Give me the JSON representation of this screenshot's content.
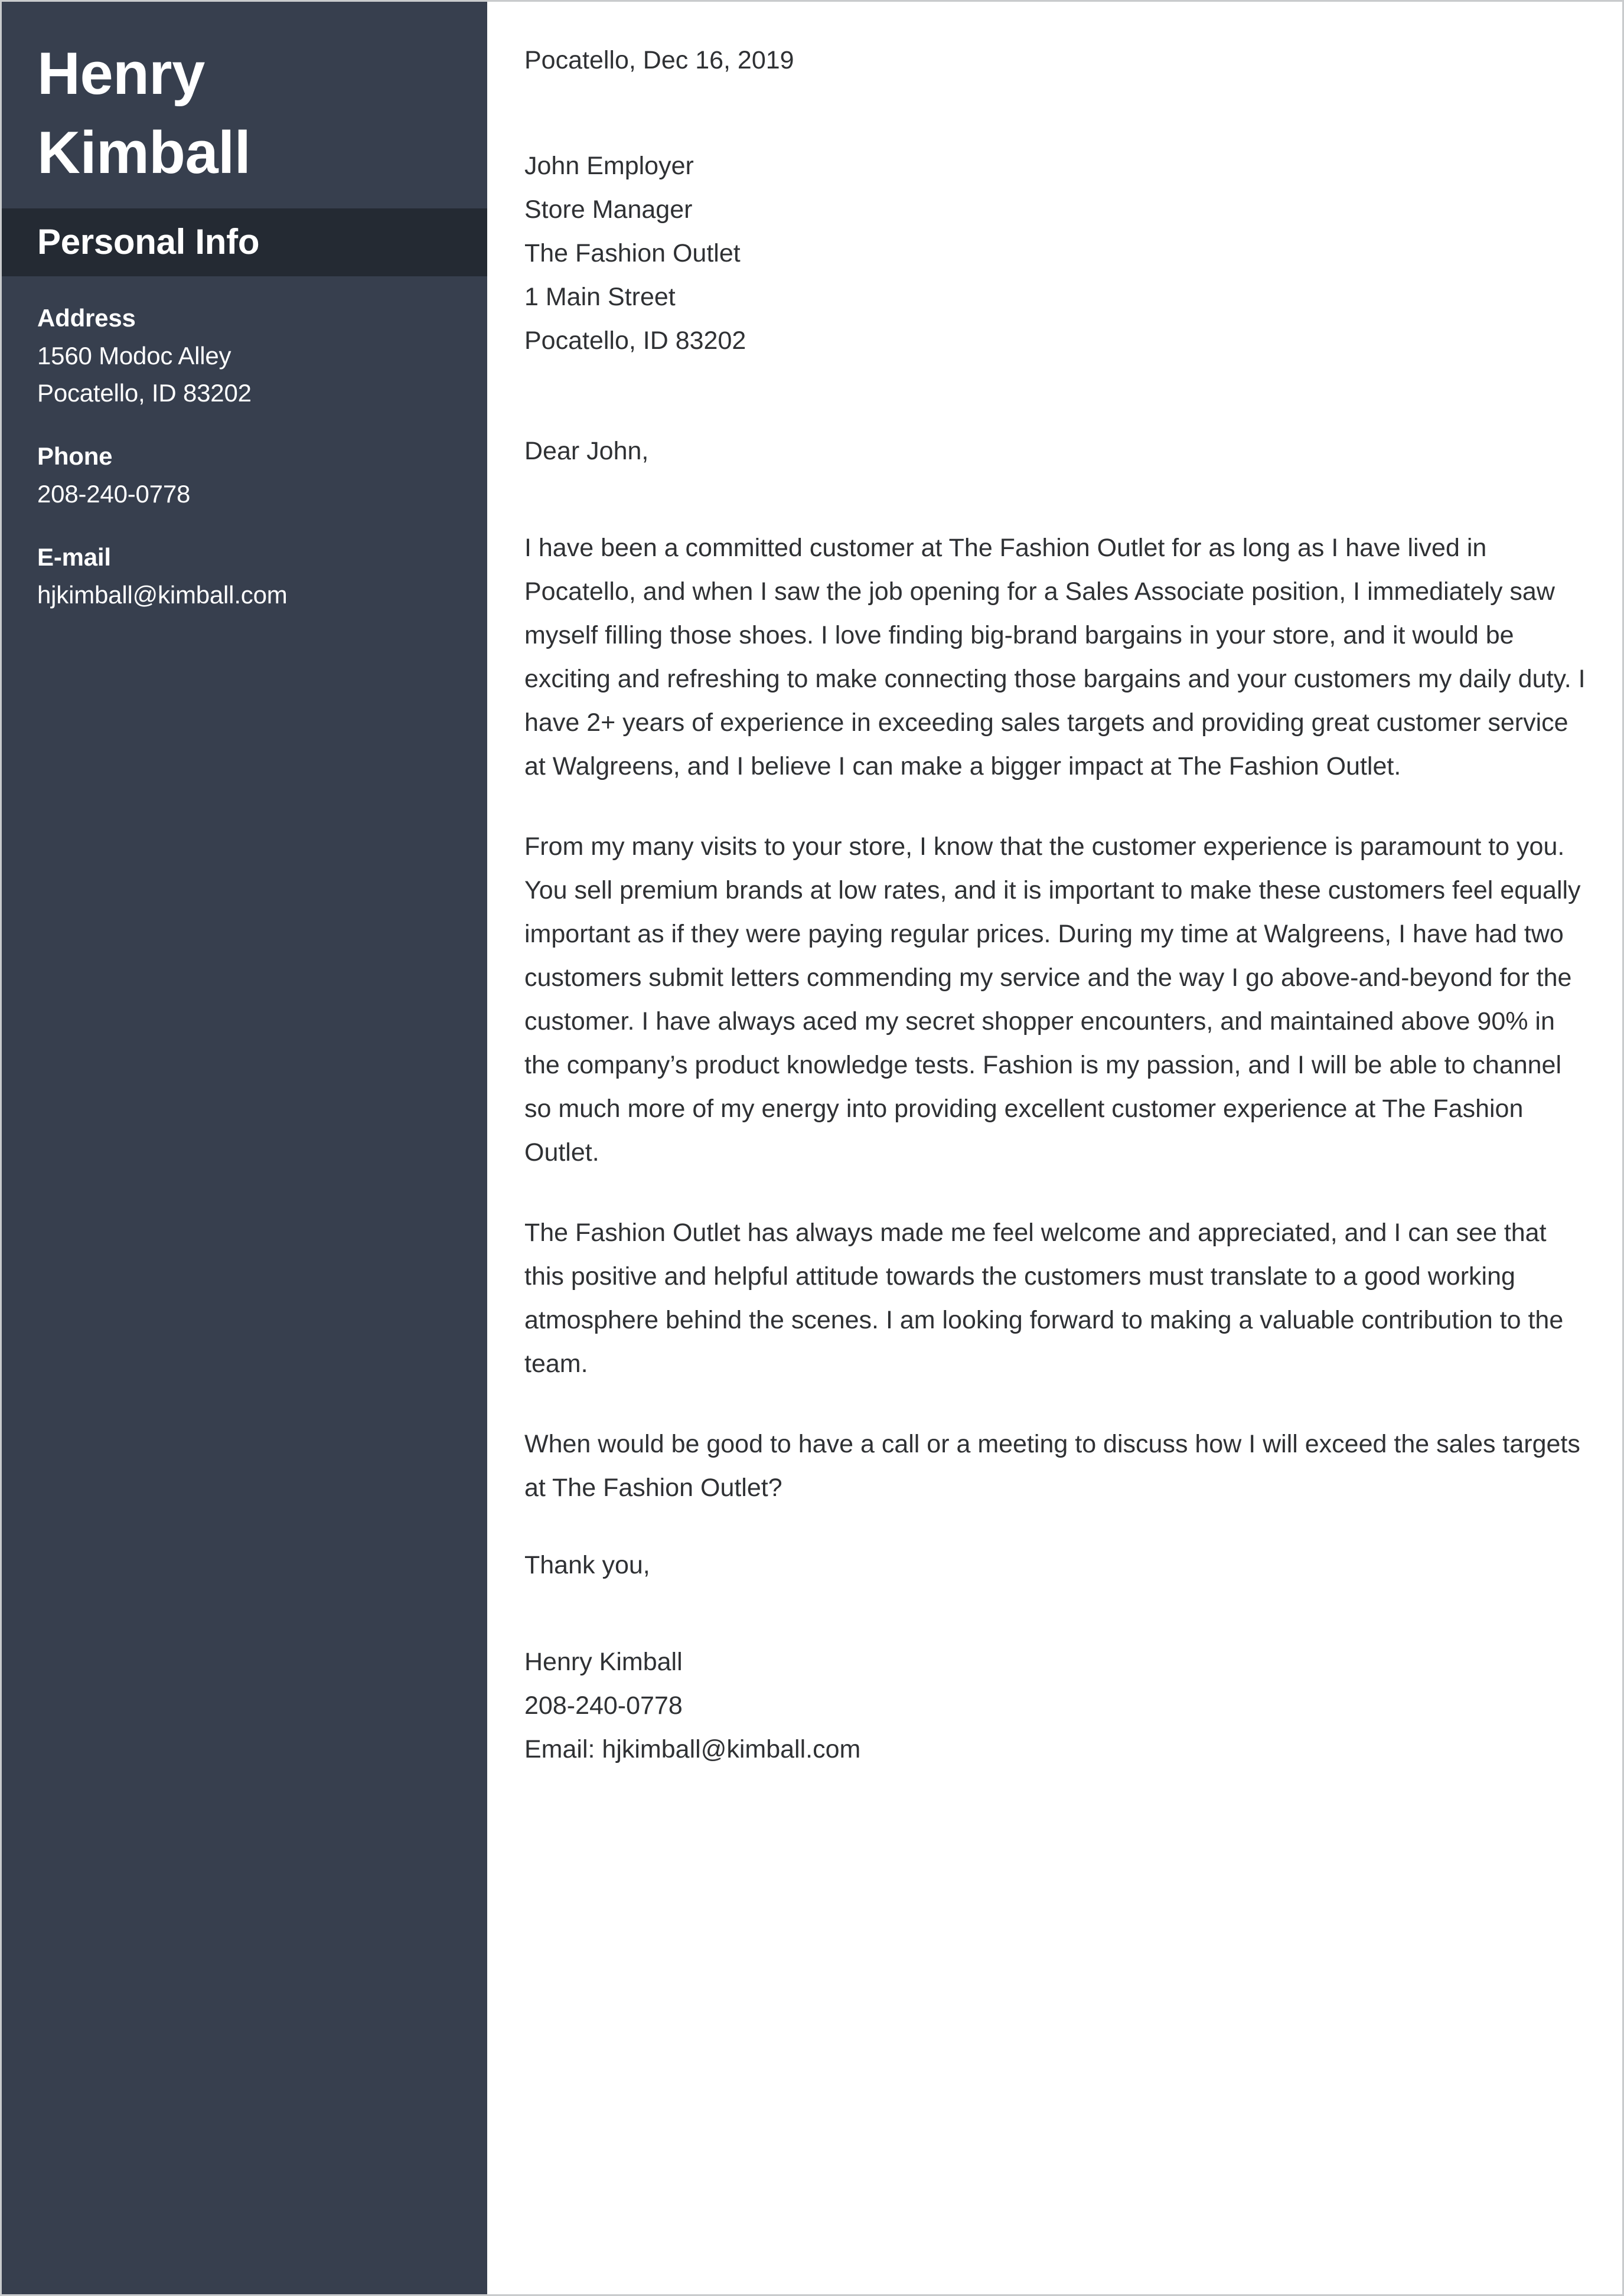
{
  "theme": {
    "sidebar_bg": "#373f4e",
    "section_band_bg": "#242a33",
    "sidebar_text": "#ffffff",
    "letter_bg": "#ffffff",
    "letter_text": "#2f3134",
    "page_border": "#c9cbcd"
  },
  "sidebar": {
    "first_name": "Henry",
    "last_name": "Kimball",
    "section_title": "Personal Info",
    "info": [
      {
        "label": "Address",
        "lines": [
          "1560 Modoc Alley",
          "Pocatello, ID 83202"
        ]
      },
      {
        "label": "Phone",
        "lines": [
          "208-240-0778"
        ]
      },
      {
        "label": "E-mail",
        "lines": [
          "hjkimball@kimball.com"
        ]
      }
    ]
  },
  "letter": {
    "date_line": "Pocatello, Dec 16, 2019",
    "recipient": [
      "John Employer",
      "Store Manager",
      "The Fashion Outlet",
      "1 Main Street",
      "Pocatello, ID 83202"
    ],
    "salutation": "Dear John,",
    "paragraphs": [
      "I have been a committed customer at The Fashion Outlet for as long as I have lived in Pocatello, and when I saw the job opening for a Sales Associate position, I immediately saw myself filling those shoes. I love finding big-brand bargains in your store, and it would be exciting and refreshing to make connecting those bargains and your customers my daily duty. I have 2+ years of experience in exceeding sales targets and providing great customer service at Walgreens, and I believe I can make a bigger impact at The Fashion Outlet.",
      "From my many visits to your store, I know that the customer experience is paramount to you. You sell premium brands at low rates, and it is important to make these customers feel equally important as if they were paying regular prices. During my time at Walgreens, I have had two customers submit letters commending my service and the way I go above-and-beyond for the customer. I have always aced my secret shopper encounters, and maintained above 90% in the company’s product knowledge tests. Fashion is my passion, and I will be able to channel so much more of my energy into providing excellent customer experience at The Fashion Outlet.",
      "The Fashion Outlet has always made me feel welcome and appreciated, and I can see that this positive and helpful attitude towards the customers must translate to a good working atmosphere behind the scenes. I am looking forward to making a valuable contribution to the team.",
      "When would be good to have a call or a meeting to discuss how I will exceed the sales targets at The Fashion Outlet?"
    ],
    "signoff": "Thank you,",
    "signature": [
      "Henry Kimball",
      "208-240-0778",
      "Email: hjkimball@kimball.com"
    ]
  }
}
